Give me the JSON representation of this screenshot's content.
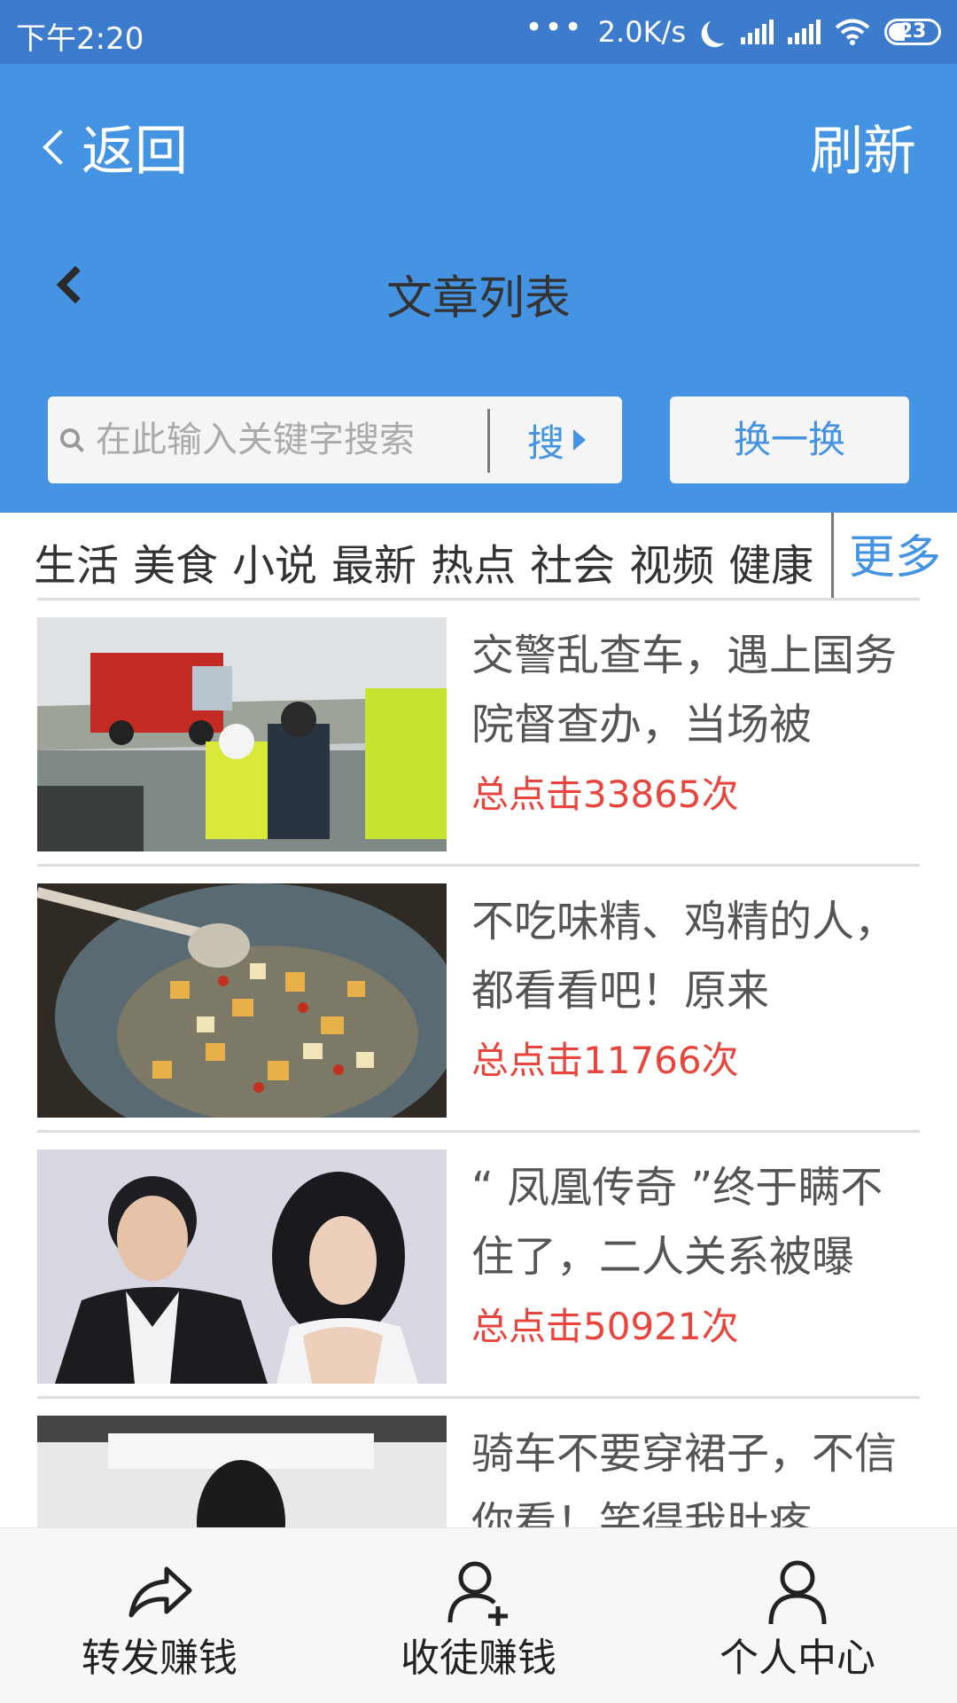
{
  "status_bar": {
    "time": "下午2:20",
    "speed": "2.0K/s",
    "battery": "23"
  },
  "nav": {
    "back_label": "返回",
    "refresh_label": "刷新"
  },
  "header": {
    "title": "文章列表"
  },
  "search": {
    "placeholder": "在此输入关键字搜索",
    "button_label": "搜",
    "swap_label": "换一换"
  },
  "categories": {
    "items": [
      "生活",
      "美食",
      "小说",
      "最新",
      "热点",
      "社会",
      "视频",
      "健康"
    ],
    "more_label": "更多"
  },
  "articles": [
    {
      "title": "交警乱查车，遇上国务院督查办，当场被",
      "clicks": "总点击33865次",
      "image": "traffic-police-photo"
    },
    {
      "title": "不吃味精、鸡精的人，都看看吧！原来",
      "clicks": "总点击11766次",
      "image": "wok-cooking-photo"
    },
    {
      "title": "“ 凤凰传奇 ”终于瞒不住了，二人关系被曝",
      "clicks": "总点击50921次",
      "image": "couple-portrait-photo"
    },
    {
      "title": "骑车不要穿裙子，不信你看！笑得我肚疼",
      "clicks": "",
      "image": "woman-silhouette-photo"
    }
  ],
  "tabs": [
    {
      "label": "转发赚钱",
      "icon": "share-icon"
    },
    {
      "label": "收徒赚钱",
      "icon": "add-user-icon"
    },
    {
      "label": "个人中心",
      "icon": "user-icon"
    }
  ],
  "colors": {
    "primary": "#4594e3",
    "status_bar": "#3d7ccc",
    "clicks": "#e8453c"
  }
}
